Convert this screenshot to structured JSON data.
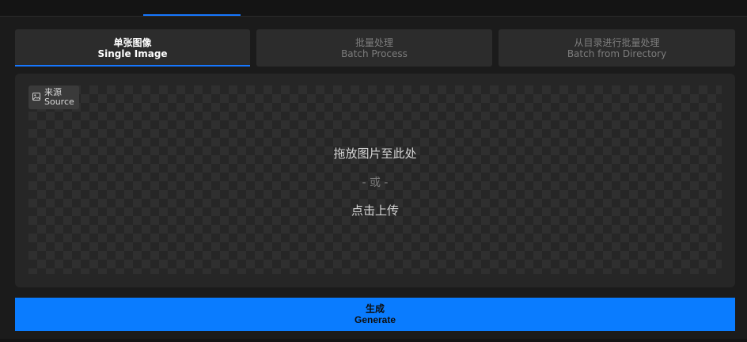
{
  "tabs": [
    {
      "cn": "单张图像",
      "en": "Single Image",
      "active": true
    },
    {
      "cn": "批量处理",
      "en": "Batch Process",
      "active": false
    },
    {
      "cn": "从目录进行批量处理",
      "en": "Batch from Directory",
      "active": false
    }
  ],
  "source": {
    "cn": "来源",
    "en": "Source",
    "icon": "image-icon"
  },
  "dropzone": {
    "line1": "拖放图片至此处",
    "line2": "- 或 -",
    "line3": "点击上传"
  },
  "generate": {
    "cn": "生成",
    "en": "Generate"
  },
  "colors": {
    "accent": "#1677ff",
    "button": "#0a7cff"
  }
}
